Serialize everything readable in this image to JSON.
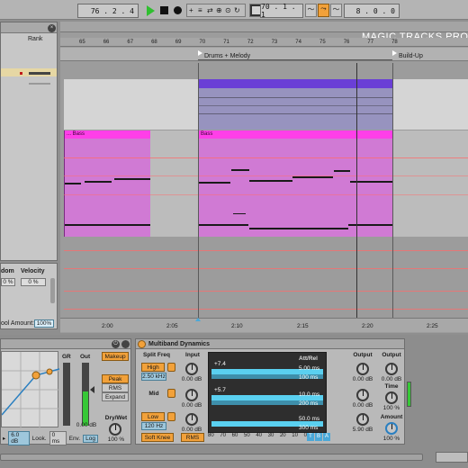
{
  "transport": {
    "position": "76 . 2 . 4",
    "loop_start": "70 . 1 . 1",
    "loop_length": "8 . 0 . 0"
  },
  "watermark": "MAGIC TRACKS PRO",
  "arrangement": {
    "bar_numbers": [
      "65",
      "66",
      "67",
      "68",
      "69",
      "70",
      "71",
      "72",
      "73",
      "74",
      "75",
      "76",
      "77",
      "78"
    ],
    "locators": [
      {
        "label": "Drums + Melody"
      },
      {
        "label": "Build-Up"
      }
    ],
    "time_labels": [
      "2:00",
      "2:05",
      "2:10",
      "2:15",
      "2:20",
      "2:25"
    ],
    "clip_labels": [
      "... Bass",
      "Bass"
    ]
  },
  "left_panel": {
    "rank_header": "Rank",
    "random_label": "dom",
    "velocity_label": "Velocity",
    "random_value": "0 %",
    "velocity_value": "0 %",
    "amount_label": "ool Amount:",
    "amount_value": "100%"
  },
  "compressor": {
    "gr_label": "GR",
    "out_label": "Out",
    "makeup": "Makeup",
    "peak": "Peak",
    "rms": "RMS",
    "expand": "Expand",
    "out_value": "0.00 dB",
    "drywet_label": "Dry/Wet",
    "drywet_value": "100 %",
    "ratio_value": "6.0 dB",
    "look_label": "Look.",
    "look_value": "0 ms",
    "env_label": "Env.",
    "env_value": "Log"
  },
  "multiband": {
    "title": "Multiband Dynamics",
    "split_freq": "Split Freq",
    "input": "Input",
    "high": "High",
    "high_freq": "2.50 kHz",
    "mid": "Mid",
    "low": "Low",
    "low_freq": "120 Hz",
    "in_high": "0.00 dB",
    "in_mid": "0.00 dB",
    "in_low": "0.00 dB",
    "band_high_val": "+7.4",
    "band_mid_val": "+5.7",
    "att_rel": "Att/Rel",
    "att_high": "5.00 ms",
    "rel_high": "100 ms",
    "att_mid": "10.0 ms",
    "rel_mid": "200 ms",
    "att_low": "50.0 ms",
    "rel_low": "300 ms",
    "output": "Output",
    "out_high": "0.00 dB",
    "out_mid": "0.00 dB",
    "out_low": "5.90 dB",
    "soft_knee": "Soft Knee",
    "rms": "RMS",
    "scale": [
      "80",
      "70",
      "60",
      "50",
      "40",
      "30",
      "20",
      "10",
      "0"
    ],
    "t_btn": "T",
    "b_btn": "B",
    "a_btn": "A",
    "out2_label": "Output",
    "out2_value": "0.00 dB",
    "time_label": "Time",
    "time_value": "100 %",
    "amount_label": "Amount",
    "amount_value": "100 %"
  }
}
